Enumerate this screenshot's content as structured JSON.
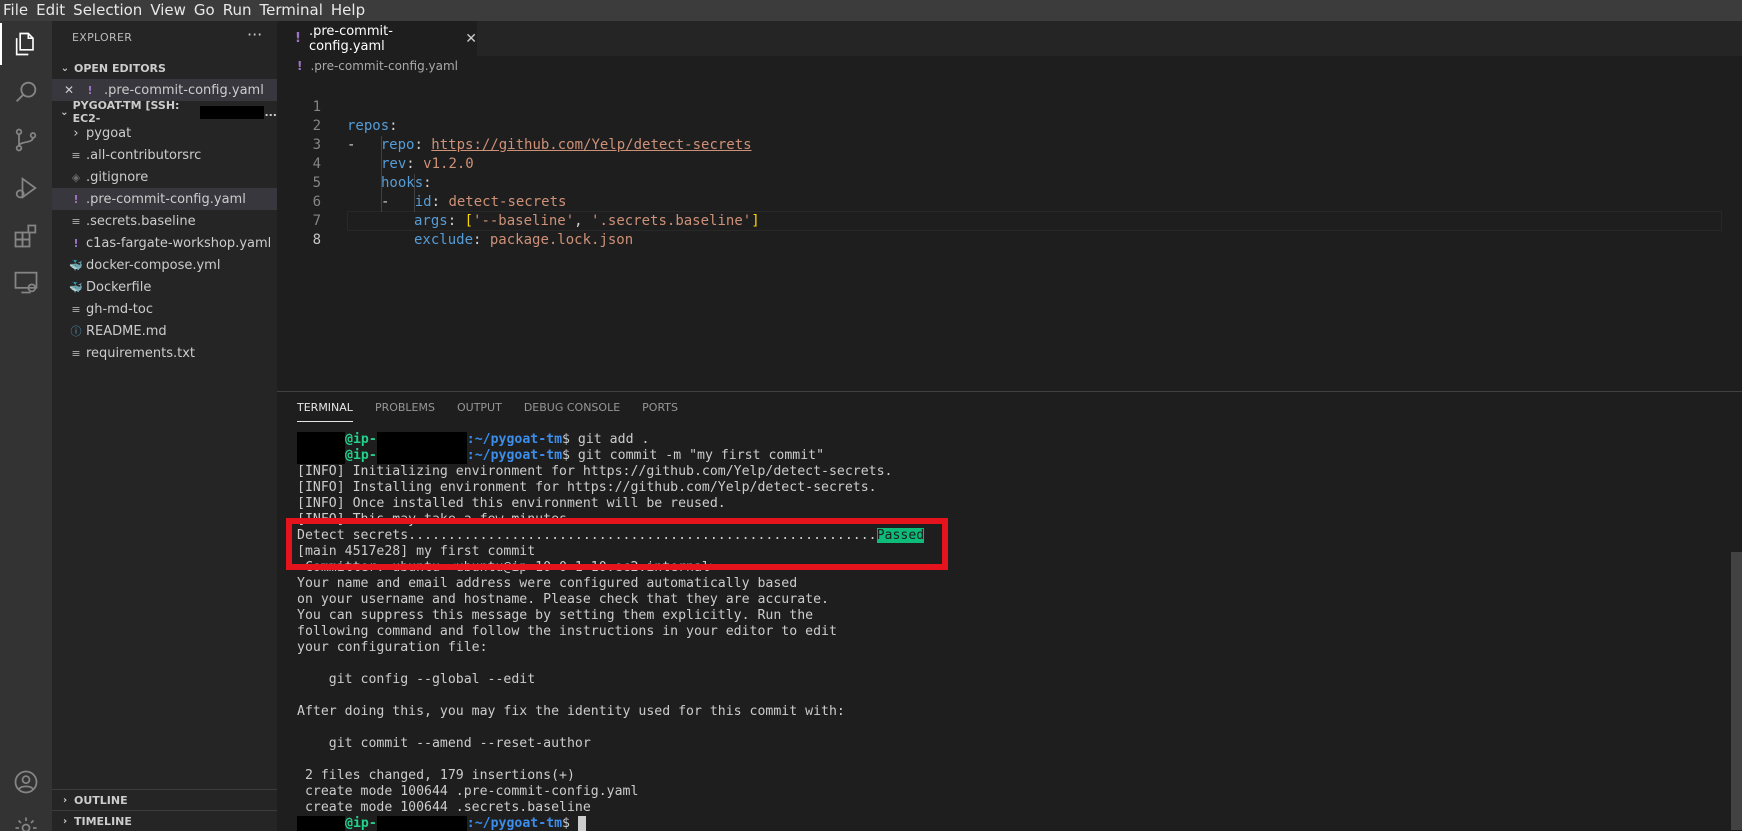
{
  "menu": [
    "File",
    "Edit",
    "Selection",
    "View",
    "Go",
    "Run",
    "Terminal",
    "Help"
  ],
  "activity_bar": [
    "explorer-icon",
    "search-icon",
    "source-control-icon",
    "run-debug-icon",
    "extensions-icon",
    "remote-explorer-icon",
    "account-icon",
    "settings-gear-icon"
  ],
  "sidebar": {
    "title": "EXPLORER",
    "more": "···",
    "open_editors": {
      "label": "OPEN EDITORS",
      "items": [
        {
          "close": "✕",
          "icon": "!",
          "name": ".pre-commit-config.yaml"
        }
      ]
    },
    "workspace": {
      "label": "PYGOAT-TM [SSH: EC2-",
      "label_suffix": "..."
    },
    "files": [
      {
        "icon": "›",
        "name": "pygoat",
        "kind": "folder"
      },
      {
        "icon": "≡",
        "name": ".all-contributorsrc",
        "kind": "lines"
      },
      {
        "icon": "◈",
        "name": ".gitignore",
        "kind": "git"
      },
      {
        "icon": "!",
        "name": ".pre-commit-config.yaml",
        "kind": "yaml"
      },
      {
        "icon": "≡",
        "name": ".secrets.baseline",
        "kind": "lines"
      },
      {
        "icon": "!",
        "name": "c1as-fargate-workshop.yaml",
        "kind": "yaml"
      },
      {
        "icon": "🐳",
        "name": "docker-compose.yml",
        "kind": "compose"
      },
      {
        "icon": "🐳",
        "name": "Dockerfile",
        "kind": "docker"
      },
      {
        "icon": "≡",
        "name": "gh-md-toc",
        "kind": "lines"
      },
      {
        "icon": "ⓘ",
        "name": "README.md",
        "kind": "info"
      },
      {
        "icon": "≡",
        "name": "requirements.txt",
        "kind": "lines"
      }
    ],
    "outline": "OUTLINE",
    "timeline": "TIMELINE"
  },
  "editor": {
    "tab": {
      "icon": "!",
      "title": ".pre-commit-config.yaml",
      "close": "✕"
    },
    "breadcrumb": {
      "icon": "!",
      "file": ".pre-commit-config.yaml"
    },
    "line_numbers": [
      "1",
      "2",
      "3",
      "4",
      "5",
      "6",
      "7",
      "8"
    ],
    "code": {
      "l1_key": "repos",
      "l1_colon": ":",
      "l2_dash": "-   ",
      "l2_key": "repo",
      "l2_colon": ": ",
      "l2_val": "https://github.com/Yelp/detect-secrets",
      "l3_key": "rev",
      "l3_colon": ": ",
      "l3_val": "v1.2.0",
      "l4_key": "hooks",
      "l4_colon": ":",
      "l5_dash": "-   ",
      "l5_key": "id",
      "l5_colon": ": ",
      "l5_val": "detect-secrets",
      "l6_key": "args",
      "l6_colon": ": ",
      "l6_open": "[",
      "l6_v1": "'--baseline'",
      "l6_comma": ", ",
      "l6_v2": "'.secrets.baseline'",
      "l6_close": "]",
      "l7_key": "exclude",
      "l7_colon": ": ",
      "l7_val": "package.lock.json"
    }
  },
  "panel": {
    "tabs": [
      "TERMINAL",
      "PROBLEMS",
      "OUTPUT",
      "DEBUG CONSOLE",
      "PORTS"
    ],
    "terminal": {
      "host_prefix": "@ip-",
      "path": ":~/pygoat-tm",
      "cmd1": "$ git add .",
      "cmd2": "$ git commit -m \"my first commit\"",
      "info1": "[INFO] Initializing environment for https://github.com/Yelp/detect-secrets.",
      "info2": "[INFO] Installing environment for https://github.com/Yelp/detect-secrets.",
      "info3": "[INFO] Once installed this environment will be reused.",
      "info4_partial": "[INFO] This may take a few minutes...",
      "detect": "Detect secrets...........................................................",
      "passed": "Passed",
      "main_commit": "[main 4517e28] my first commit",
      "committer_partial": " Committer: ubuntu <ubuntu@ip-10-0-1-10.ec2.internal>",
      "msg1": "Your name and email address were configured automatically based",
      "msg2": "on your username and hostname. Please check that they are accurate.",
      "msg3": "You can suppress this message by setting them explicitly. Run the",
      "msg4": "following command and follow the instructions in your editor to edit",
      "msg5": "your configuration file:",
      "cfg_cmd": "    git config --global --edit",
      "after": "After doing this, you may fix the identity used for this commit with:",
      "amend_cmd": "    git commit --amend --reset-author",
      "changed": " 2 files changed, 179 insertions(+)",
      "create1": " create mode 100644 .pre-commit-config.yaml",
      "create2": " create mode 100644 .secrets.baseline",
      "prompt_end": "$ "
    }
  }
}
